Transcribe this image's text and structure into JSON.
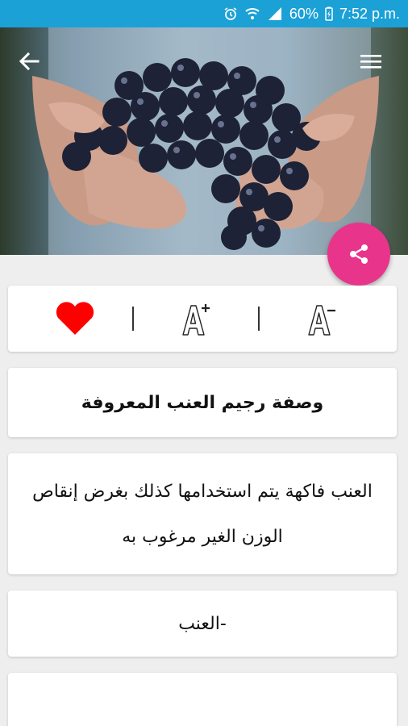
{
  "status_bar": {
    "battery": "60%",
    "time": "7:52 p.m.",
    "icons": [
      "alarm-icon",
      "wifi-icon",
      "signal-icon",
      "battery-icon"
    ]
  },
  "header": {
    "image": "hands-holding-black-grapes",
    "back_icon": "arrow-back-icon",
    "menu_icon": "hamburger-menu-icon"
  },
  "fab": {
    "icon": "share-icon",
    "color": "#e9348b"
  },
  "toolbar": {
    "favorite_icon": "heart-icon",
    "favorite_color": "#ff0000",
    "increase_font_icon": "font-increase-icon",
    "decrease_font_icon": "font-decrease-icon"
  },
  "article": {
    "title": "وصفة رجيم العنب المعروفة",
    "paragraph": "العنب فاكهة يتم استخدامها كذلك بغرض إنقاص الوزن الغير مرغوب به",
    "list_item": "-العنب"
  },
  "colors": {
    "status_bar": "#1ba1d6",
    "background": "#eeeeee"
  }
}
